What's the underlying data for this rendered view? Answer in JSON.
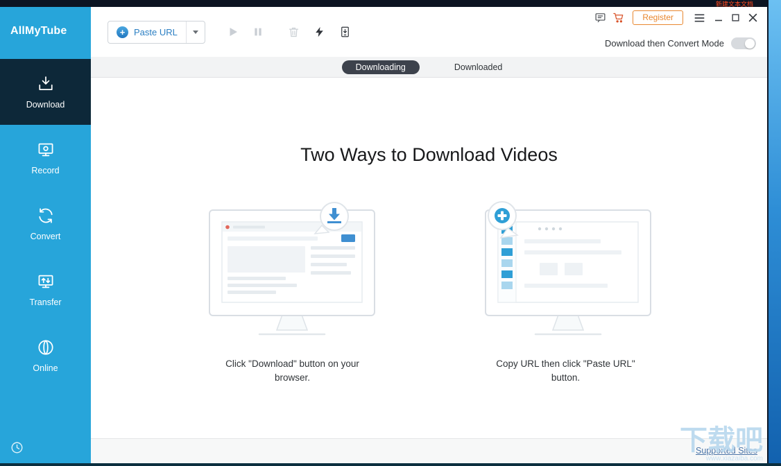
{
  "desktop": {
    "top_right_text": "新建文本文档"
  },
  "titlebar": {
    "register_label": "Register"
  },
  "sidebar": {
    "logo": "AllMyTube",
    "items": [
      {
        "label": "Download"
      },
      {
        "label": "Record"
      },
      {
        "label": "Convert"
      },
      {
        "label": "Transfer"
      },
      {
        "label": "Online"
      }
    ]
  },
  "toolbar": {
    "paste_url_label": "Paste URL",
    "mode_label": "Download then Convert Mode"
  },
  "tabs": [
    {
      "label": "Downloading"
    },
    {
      "label": "Downloaded"
    }
  ],
  "content": {
    "heading": "Two Ways to Download Videos",
    "left_caption": "Click \"Download\" button on your browser.",
    "right_caption": "Copy URL then click \"Paste URL\" button."
  },
  "footer": {
    "supported_sites": "Supported Sites"
  },
  "watermark": {
    "text": "下载吧",
    "url": "www.xiazaiba.com"
  },
  "colors": {
    "sidebar_blue": "#27a5da",
    "sidebar_active": "#0d2839",
    "accent_blue": "#2f8fd0",
    "register_orange": "#e8872f",
    "cart_orange": "#d9542b",
    "tab_pill_dark": "#3d424c",
    "link_blue": "#4a74a8"
  }
}
